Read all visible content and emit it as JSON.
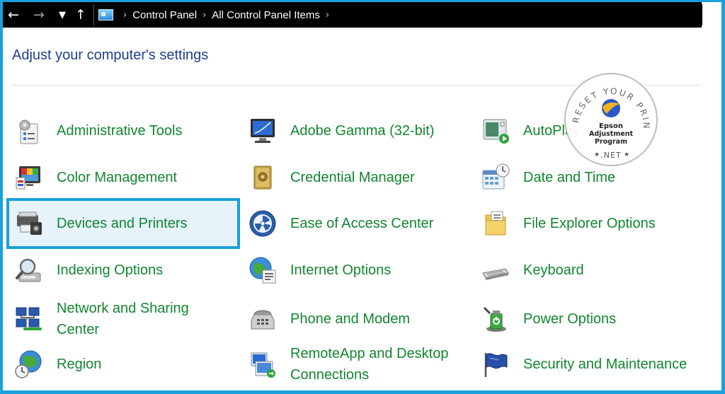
{
  "nav": {
    "back_icon": "arrow-left-icon",
    "forward_icon": "arrow-right-icon",
    "recent_icon": "chevron-down-icon",
    "up_icon": "arrow-up-icon"
  },
  "breadcrumb": [
    "Control Panel",
    "All Control Panel Items"
  ],
  "heading": "Adjust your computer's settings",
  "items": [
    {
      "label": "Administrative Tools",
      "icon": "administrative-tools-icon"
    },
    {
      "label": "Adobe Gamma (32-bit)",
      "icon": "adobe-gamma-icon"
    },
    {
      "label": "AutoPlay",
      "icon": "autoplay-icon"
    },
    {
      "label": "Color Management",
      "icon": "color-management-icon"
    },
    {
      "label": "Credential Manager",
      "icon": "credential-manager-icon"
    },
    {
      "label": "Date and Time",
      "icon": "date-time-icon"
    },
    {
      "label": "Devices and Printers",
      "icon": "devices-printers-icon",
      "selected": true
    },
    {
      "label": "Ease of Access Center",
      "icon": "ease-of-access-icon"
    },
    {
      "label": "File Explorer Options",
      "icon": "folder-options-icon"
    },
    {
      "label": "Indexing Options",
      "icon": "indexing-options-icon"
    },
    {
      "label": "Internet Options",
      "icon": "internet-options-icon"
    },
    {
      "label": "Keyboard",
      "icon": "keyboard-icon"
    },
    {
      "label": "Network and Sharing Center",
      "icon": "network-sharing-icon"
    },
    {
      "label": "Phone and Modem",
      "icon": "phone-modem-icon"
    },
    {
      "label": "Power Options",
      "icon": "power-options-icon"
    },
    {
      "label": "Region",
      "icon": "region-icon"
    },
    {
      "label": "RemoteApp and Desktop Connections",
      "icon": "remoteapp-icon"
    },
    {
      "label": "Security and Maintenance",
      "icon": "security-maintenance-icon"
    }
  ],
  "watermark": {
    "arc_text": "RESET YOUR PRINTER",
    "line1": "Epson",
    "line2": "Adjustment",
    "line3": "Program",
    "bottom": ".NET"
  },
  "colors": {
    "accent": "#1aa0db",
    "link": "#12862f",
    "heading": "#1e3f8f"
  }
}
